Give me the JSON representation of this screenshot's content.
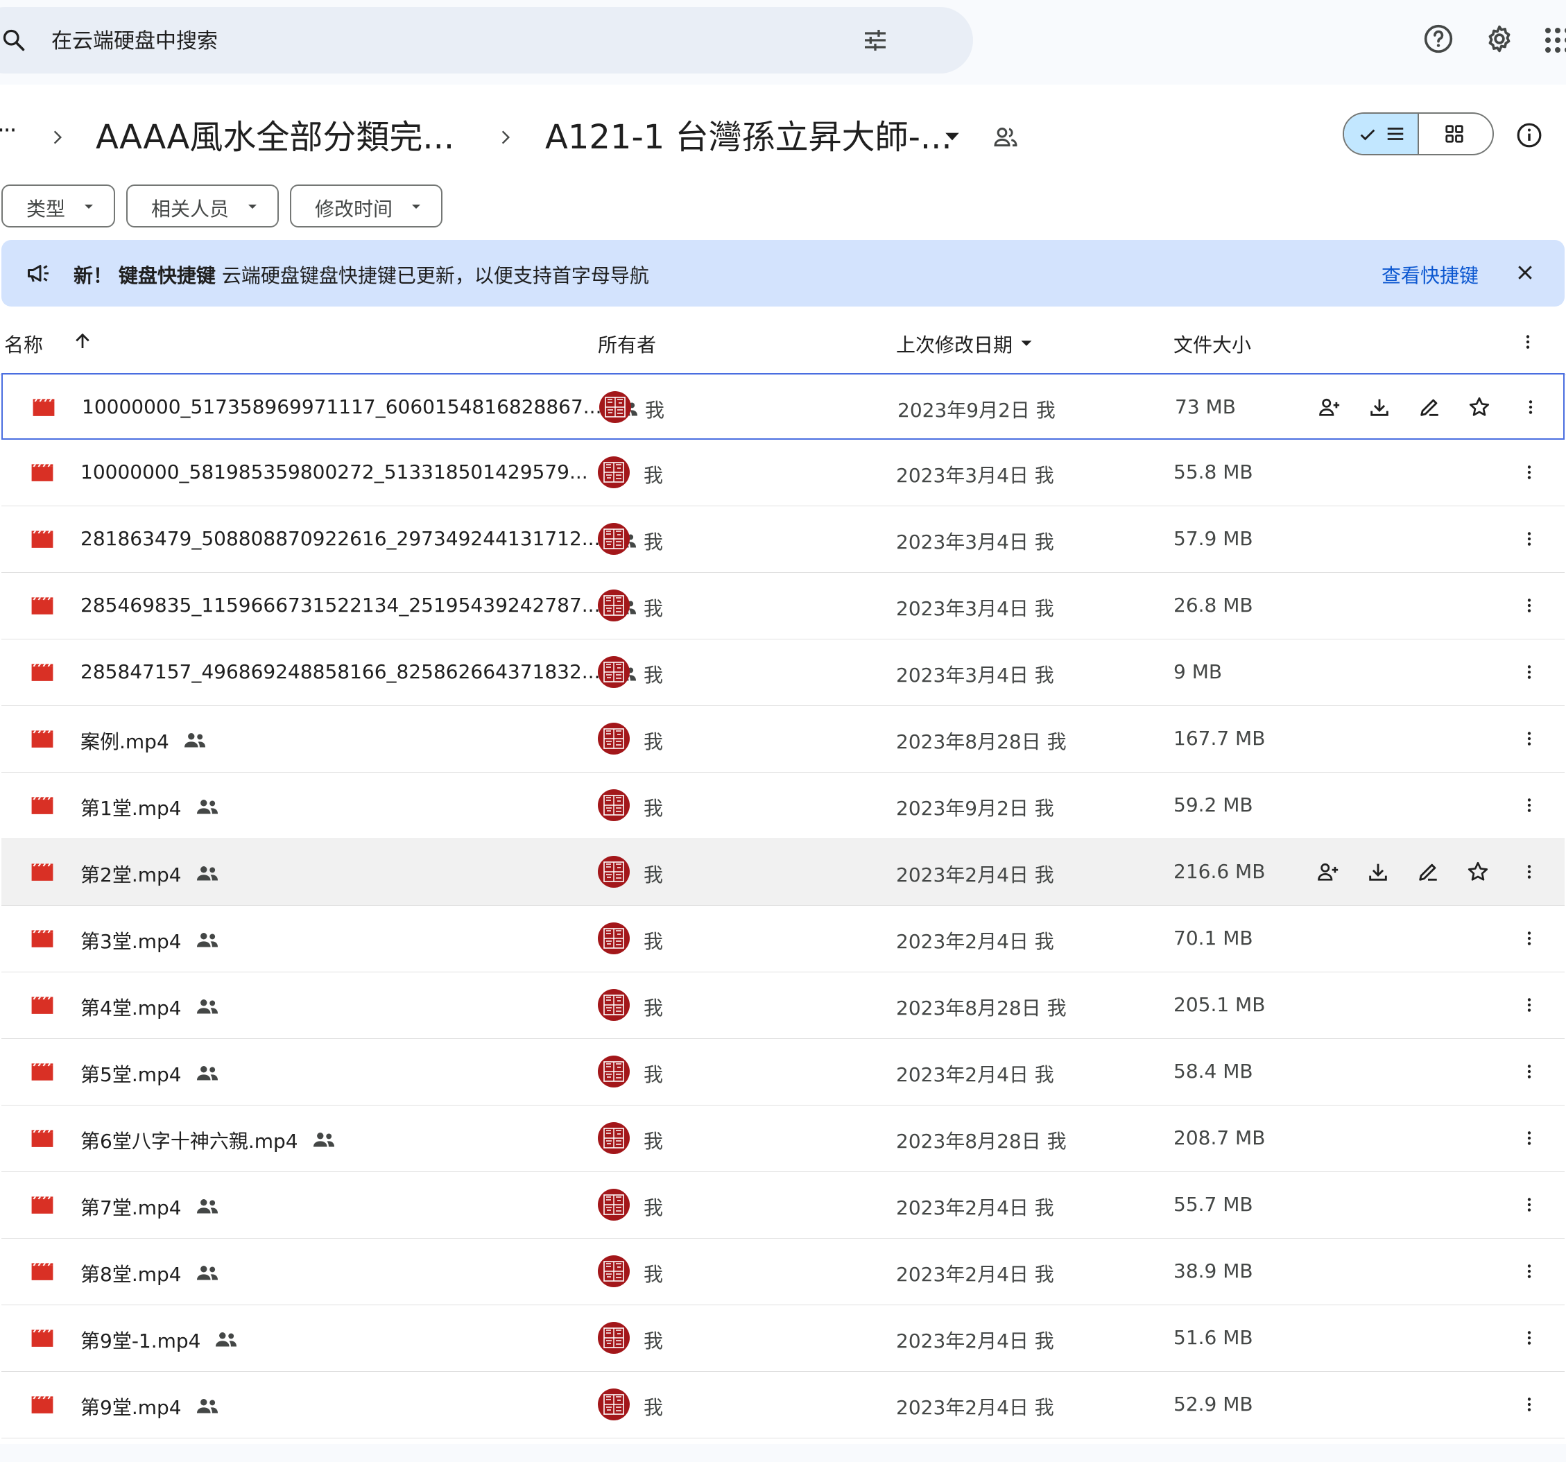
{
  "search": {
    "placeholder": "在云端硬盘中搜索"
  },
  "breadcrumb": {
    "more": "···",
    "parent": "AAAA風水全部分類完...",
    "current": "A121-1 台灣孫立昇大師-..."
  },
  "filters": {
    "type": "类型",
    "people": "相关人员",
    "modified": "修改时间"
  },
  "banner": {
    "new_label": "新！",
    "title": "键盘快捷键",
    "message": "云端硬盘键盘快捷键已更新，以便支持首字母导航",
    "link": "查看快捷键"
  },
  "columns": {
    "name": "名称",
    "owner": "所有者",
    "modified": "上次修改日期",
    "size": "文件大小"
  },
  "avatar_color": "#a3171a",
  "file_icon_color": "#d93025",
  "files": [
    {
      "name": "10000000_517358969971117_6060154816828867...",
      "owner": "我",
      "modified": "2023年9月2日 我",
      "size": "73 MB"
    },
    {
      "name": "10000000_581985359800272_513318501429579...",
      "owner": "我",
      "modified": "2023年3月4日 我",
      "size": "55.8 MB"
    },
    {
      "name": "281863479_508808870922616_297349244131712...",
      "owner": "我",
      "modified": "2023年3月4日 我",
      "size": "57.9 MB"
    },
    {
      "name": "285469835_1159666731522134_25195439242787...",
      "owner": "我",
      "modified": "2023年3月4日 我",
      "size": "26.8 MB"
    },
    {
      "name": "285847157_496869248858166_825862664371832...",
      "owner": "我",
      "modified": "2023年3月4日 我",
      "size": "9 MB"
    },
    {
      "name": "案例.mp4",
      "owner": "我",
      "modified": "2023年8月28日 我",
      "size": "167.7 MB"
    },
    {
      "name": "第1堂.mp4",
      "owner": "我",
      "modified": "2023年9月2日 我",
      "size": "59.2 MB"
    },
    {
      "name": "第2堂.mp4",
      "owner": "我",
      "modified": "2023年2月4日 我",
      "size": "216.6 MB"
    },
    {
      "name": "第3堂.mp4",
      "owner": "我",
      "modified": "2023年2月4日 我",
      "size": "70.1 MB"
    },
    {
      "name": "第4堂.mp4",
      "owner": "我",
      "modified": "2023年8月28日 我",
      "size": "205.1 MB"
    },
    {
      "name": "第5堂.mp4",
      "owner": "我",
      "modified": "2023年2月4日 我",
      "size": "58.4 MB"
    },
    {
      "name": "第6堂八字十神六親.mp4",
      "owner": "我",
      "modified": "2023年8月28日 我",
      "size": "208.7 MB"
    },
    {
      "name": "第7堂.mp4",
      "owner": "我",
      "modified": "2023年2月4日 我",
      "size": "55.7 MB"
    },
    {
      "name": "第8堂.mp4",
      "owner": "我",
      "modified": "2023年2月4日 我",
      "size": "38.9 MB"
    },
    {
      "name": "第9堂-1.mp4",
      "owner": "我",
      "modified": "2023年2月4日 我",
      "size": "51.6 MB"
    },
    {
      "name": "第9堂.mp4",
      "owner": "我",
      "modified": "2023年2月4日 我",
      "size": "52.9 MB"
    }
  ]
}
